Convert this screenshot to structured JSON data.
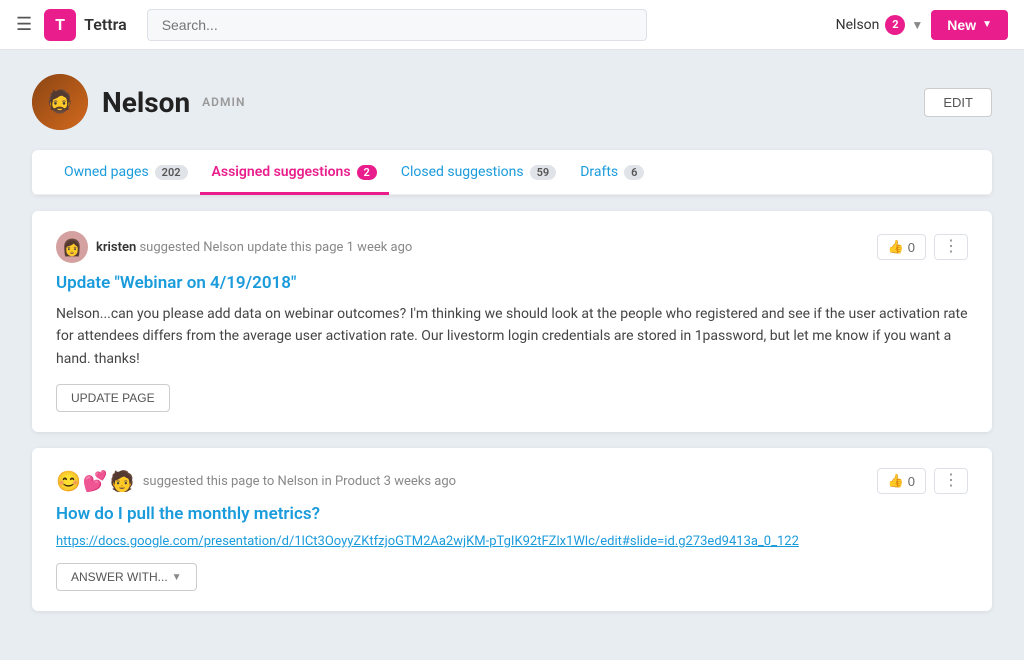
{
  "app": {
    "name": "Tettra",
    "logo_letter": "T"
  },
  "navbar": {
    "search_placeholder": "Search...",
    "user_name": "Nelson",
    "notification_count": "2",
    "new_button_label": "New"
  },
  "profile": {
    "name": "Nelson",
    "role": "ADMIN",
    "edit_button": "EDIT",
    "avatar_emoji": "👤"
  },
  "tabs": [
    {
      "id": "owned",
      "label": "Owned pages",
      "count": "202",
      "active": false
    },
    {
      "id": "assigned",
      "label": "Assigned suggestions",
      "count": "2",
      "active": true
    },
    {
      "id": "closed",
      "label": "Closed suggestions",
      "count": "59",
      "active": false
    },
    {
      "id": "drafts",
      "label": "Drafts",
      "count": "6",
      "active": false
    }
  ],
  "suggestions": [
    {
      "id": 1,
      "avatar_emoji": "👩",
      "author": "kristen",
      "meta_text": "suggested Nelson update this page 1 week ago",
      "title": "Update \"Webinar on 4/19/2018\"",
      "body": "Nelson...can you please add data on webinar outcomes? I'm thinking we should look at the people who registered and see if the user activation rate for attendees differs from the average user activation rate. Our livestorm login credentials are stored in 1password, but let me know if you want a hand. thanks!",
      "link": null,
      "thumbs_count": "0",
      "action_label": "UPDATE PAGE",
      "action_has_arrow": false
    },
    {
      "id": 2,
      "avatar_emoji": "😊💕🧑‍🦱",
      "author": "",
      "meta_text": "suggested this page to Nelson in Product 3 weeks ago",
      "title": "How do I pull the monthly metrics?",
      "body": null,
      "link": "https://docs.google.com/presentation/d/1lCt3OoyyZKtfzjoGTM2Aa2wjKM-pTgIK92tFZlx1Wlc/edit#slide=id.g273ed9413a_0_122",
      "thumbs_count": "0",
      "action_label": "ANSWER WITH...",
      "action_has_arrow": true
    }
  ]
}
